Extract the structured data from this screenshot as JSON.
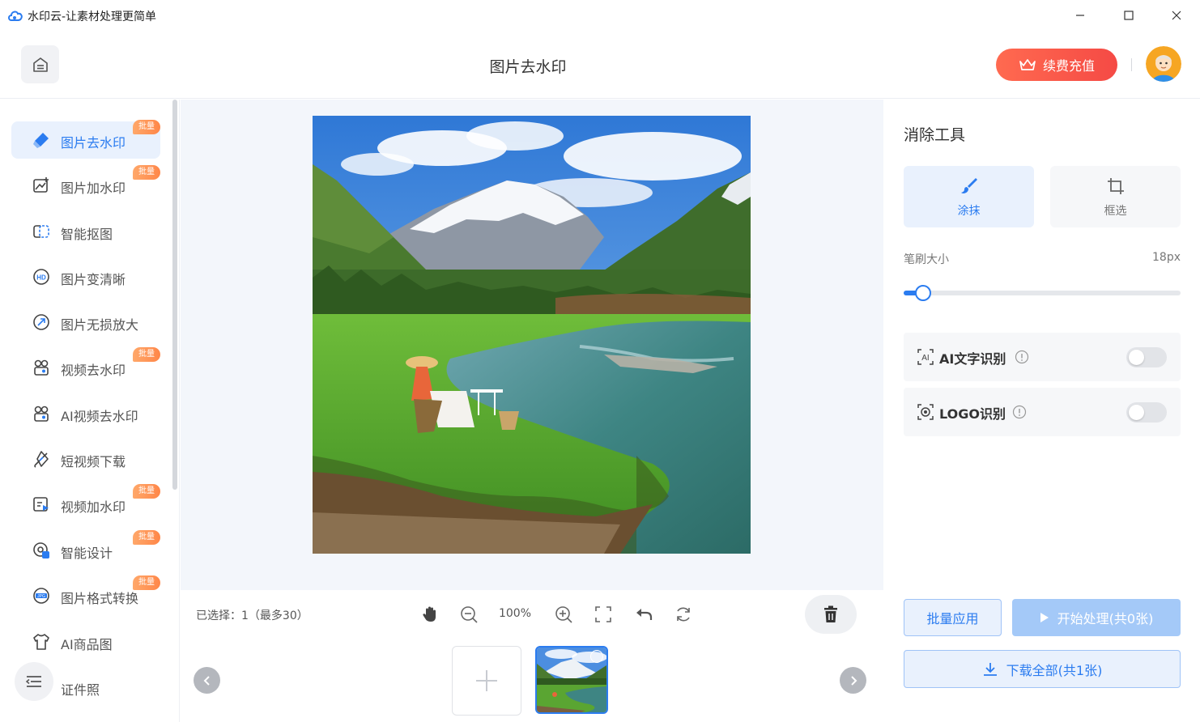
{
  "window": {
    "title": "水印云-让素材处理更简单"
  },
  "header": {
    "title": "图片去水印",
    "renew_label": "续费充值"
  },
  "sidebar": {
    "items": [
      {
        "label": "图片去水印",
        "badge": "批量",
        "icon": "eraser-icon",
        "active": true
      },
      {
        "label": "图片加水印",
        "badge": "批量",
        "icon": "image-add-icon"
      },
      {
        "label": "智能抠图",
        "badge": "",
        "icon": "cutout-icon"
      },
      {
        "label": "图片变清晰",
        "badge": "",
        "icon": "hd-icon"
      },
      {
        "label": "图片无损放大",
        "badge": "",
        "icon": "enlarge-icon"
      },
      {
        "label": "视频去水印",
        "badge": "批量",
        "icon": "video-eraser-icon"
      },
      {
        "label": "AI视频去水印",
        "badge": "",
        "icon": "ai-video-icon"
      },
      {
        "label": "短视频下载",
        "badge": "",
        "icon": "link-icon"
      },
      {
        "label": "视频加水印",
        "badge": "批量",
        "icon": "video-add-icon"
      },
      {
        "label": "智能设计",
        "badge": "批量",
        "icon": "design-icon"
      },
      {
        "label": "图片格式转换",
        "badge": "批量",
        "icon": "jpg-icon"
      },
      {
        "label": "AI商品图",
        "badge": "",
        "icon": "shirt-icon"
      },
      {
        "label": "证件照",
        "badge": "",
        "icon": "id-photo-icon"
      }
    ]
  },
  "toolbar": {
    "selected_text": "已选择：1（最多30）",
    "zoom": "100%"
  },
  "right_panel": {
    "title": "消除工具",
    "modes": [
      {
        "label": "涂抹",
        "icon": "brush-icon",
        "active": true
      },
      {
        "label": "框选",
        "icon": "crop-icon",
        "active": false
      }
    ],
    "brush_label": "笔刷大小",
    "brush_value": "18px",
    "brush_level": 0.07,
    "toggles": [
      {
        "label": "AI文字识别",
        "icon": "ai-text-icon",
        "on": false
      },
      {
        "label": "LOGO识别",
        "icon": "logo-detect-icon",
        "on": false
      }
    ],
    "batch_label": "批量应用",
    "start_label": "开始处理(共0张)",
    "download_label": "下载全部(共1张)"
  },
  "colors": {
    "accent": "#2b7cf0",
    "renew": "#f54a45",
    "badge": "#ff8648"
  }
}
